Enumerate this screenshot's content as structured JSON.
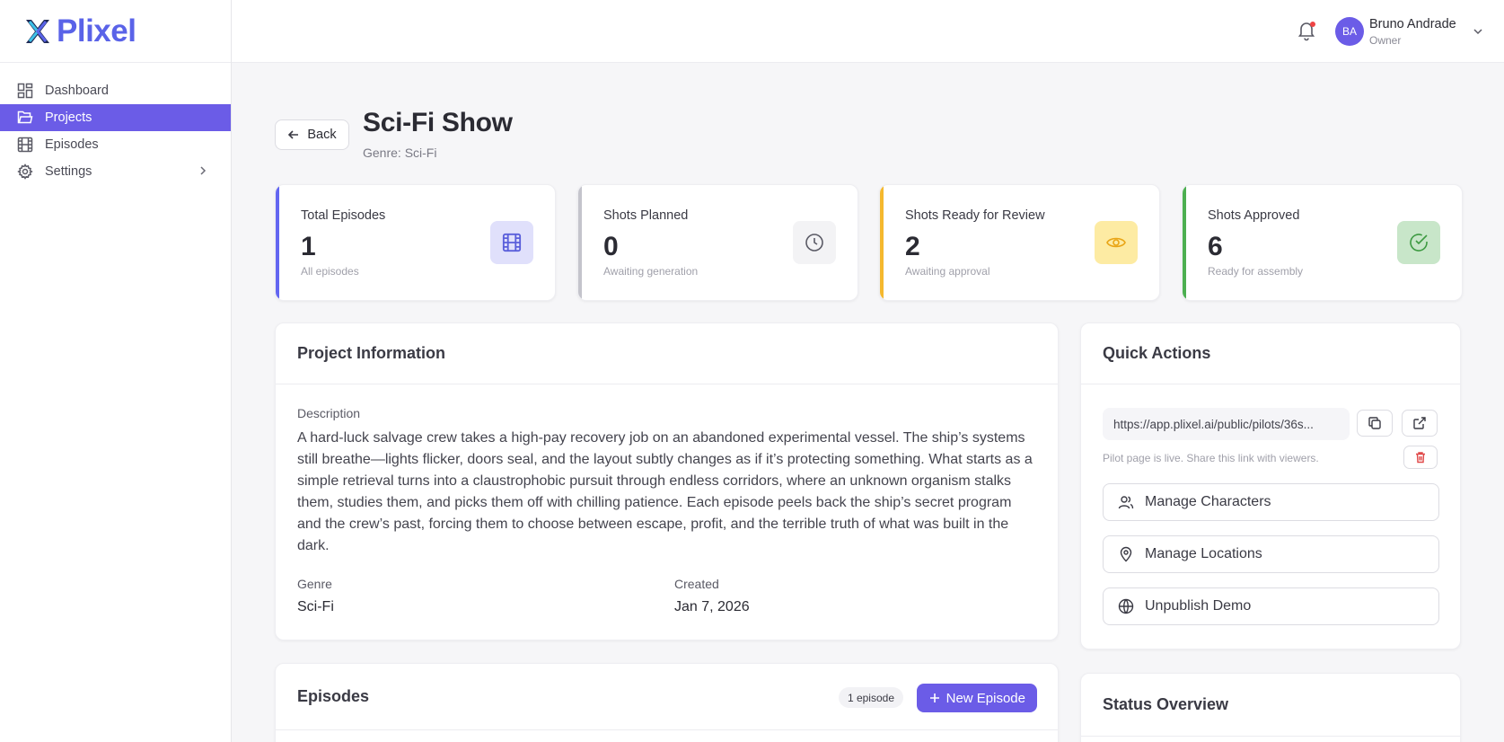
{
  "brand": {
    "name": "Plixel"
  },
  "sidebar": {
    "items": [
      {
        "label": "Dashboard",
        "icon": "dashboard-icon"
      },
      {
        "label": "Projects",
        "icon": "folder-icon",
        "active": true
      },
      {
        "label": "Episodes",
        "icon": "film-icon"
      },
      {
        "label": "Settings",
        "icon": "gear-icon",
        "has_submenu": true
      }
    ]
  },
  "header": {
    "user": {
      "initials": "BA",
      "name": "Bruno Andrade",
      "role": "Owner"
    },
    "notifications_unread": true
  },
  "page": {
    "back_label": "Back",
    "title": "Sci-Fi Show",
    "subtitle": "Genre: Sci-Fi"
  },
  "stats": [
    {
      "label": "Total Episodes",
      "value": "1",
      "hint": "All episodes",
      "color": "#6366f1",
      "icon": "film-icon"
    },
    {
      "label": "Shots Planned",
      "value": "0",
      "hint": "Awaiting generation",
      "color": "#c4c4cc",
      "icon": "clock-icon"
    },
    {
      "label": "Shots Ready for Review",
      "value": "2",
      "hint": "Awaiting approval",
      "color": "#f5b82e",
      "icon": "eye-icon"
    },
    {
      "label": "Shots Approved",
      "value": "6",
      "hint": "Ready for assembly",
      "color": "#4caf50",
      "icon": "check-circle-icon"
    }
  ],
  "project_info": {
    "title": "Project Information",
    "description_label": "Description",
    "description": "A hard-luck salvage crew takes a high-pay recovery job on an abandoned experimental vessel. The ship’s systems still breathe—lights flicker, doors seal, and the layout subtly changes as if it’s protecting something. What starts as a simple retrieval turns into a claustrophobic pursuit through endless corridors, where an unknown organism stalks them, studies them, and picks them off with chilling patience. Each episode peels back the ship’s secret program and the crew’s past, forcing them to choose between escape, profit, and the terrible truth of what was built in the dark.",
    "genre_label": "Genre",
    "genre": "Sci-Fi",
    "created_label": "Created",
    "created": "Jan 7, 2026"
  },
  "quick_actions": {
    "title": "Quick Actions",
    "url": "https://app.plixel.ai/public/pilots/36s...",
    "note": "Pilot page is live. Share this link with viewers.",
    "buttons": [
      {
        "label": "Manage Characters",
        "icon": "users-icon"
      },
      {
        "label": "Manage Locations",
        "icon": "map-pin-icon"
      },
      {
        "label": "Unpublish Demo",
        "icon": "globe-icon"
      }
    ]
  },
  "episodes": {
    "title": "Episodes",
    "count_label": "1 episode",
    "new_label": "New Episode"
  },
  "status_overview": {
    "title": "Status Overview"
  }
}
